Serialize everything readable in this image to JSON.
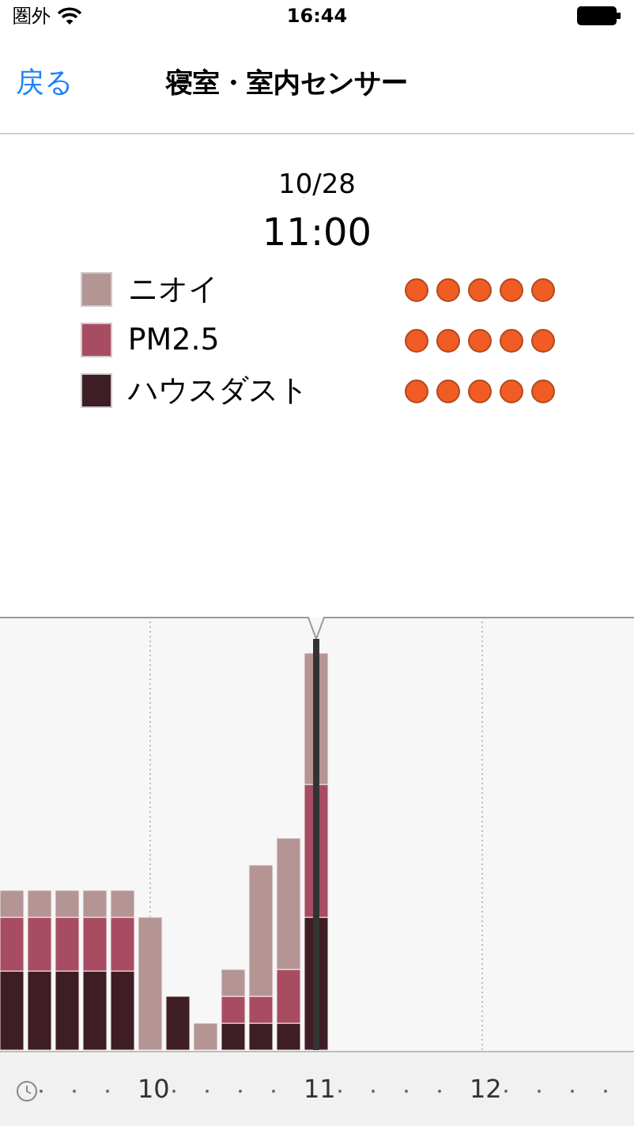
{
  "status_bar": {
    "carrier": "圏外",
    "time": "16:44"
  },
  "nav": {
    "back": "戻る",
    "title": "寝室・室内センサー"
  },
  "reading": {
    "date": "10/28",
    "time": "11:00",
    "items": [
      {
        "label": "ニオイ",
        "color": "#b59594",
        "stars": 5
      },
      {
        "label": "PM2.5",
        "color": "#a84c63",
        "stars": 5
      },
      {
        "label": "ハウスダスト",
        "color": "#3e1d24",
        "stars": 5
      }
    ]
  },
  "timeline": {
    "labels": [
      "10",
      "11",
      "12"
    ]
  }
}
